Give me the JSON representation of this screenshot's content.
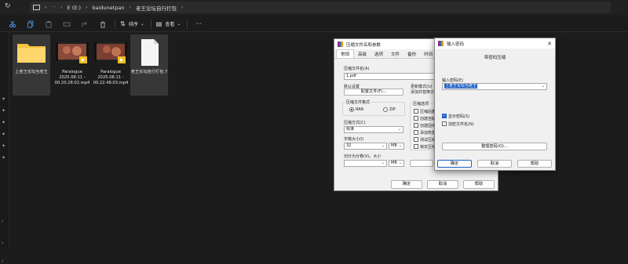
{
  "explorer": {
    "breadcrumbs": [
      "E (E:)",
      "baidunetpan",
      "老王论坛自行打包"
    ],
    "toolbar": {
      "sort_label": "排序",
      "view_label": "查看",
      "more_label": "···"
    },
    "files": [
      {
        "name": "上老王论坛当老王",
        "type": "folder"
      },
      {
        "name": "Paralogue 2025.08.11 - 00.20.28.02.mp4",
        "type": "video"
      },
      {
        "name": "Paralogue 2025.08.11 - 00.22.48.03.mp4",
        "type": "video"
      },
      {
        "name": "老王论坛自行打包.7",
        "type": "document"
      }
    ]
  },
  "archive_dialog": {
    "title": "压缩文件名和参数",
    "tabs": [
      "常规",
      "高级",
      "选项",
      "文件",
      "备份",
      "时间"
    ],
    "archive_name_label": "压缩文件名(A)",
    "archive_name_value": "1.pdf",
    "default_settings_label": "默认设置",
    "profiles_button": "配置文件(F)...",
    "update_mode_label": "更新模式(U)",
    "update_mode_value": "添加并替换文",
    "format_label": "压缩文件格式",
    "format_options": [
      "RAR",
      "ZIP"
    ],
    "method_label": "压缩方式(C)",
    "method_value": "标准",
    "dict_label": "字典大小(I)",
    "dict_value": "32",
    "dict_unit": "MB",
    "split_label": "切分为分卷(V)，大小",
    "split_unit": "MB",
    "options_label": "压缩选项",
    "options": [
      "压缩后删",
      "创建自解",
      "创建固实",
      "添加恢复",
      "测试压缩",
      "锁定压缩"
    ],
    "buttons": {
      "ok": "确定",
      "cancel": "取消",
      "help": "帮助"
    }
  },
  "password_dialog": {
    "title": "输入密码",
    "subtitle": "带密码压缩",
    "password_label": "输入密码(E)",
    "password_value": "上老王论坛当老王",
    "show_password": "显示密码(S)",
    "encrypt_names": "加密文件名(N)",
    "manage_button": "整理密码(O)...",
    "buttons": {
      "ok": "确定",
      "cancel": "取消",
      "help": "帮助"
    }
  },
  "colors": {
    "explorer_bg": "#1c1c1c",
    "selection": "#1e62c6",
    "folder": "#f4c542"
  }
}
